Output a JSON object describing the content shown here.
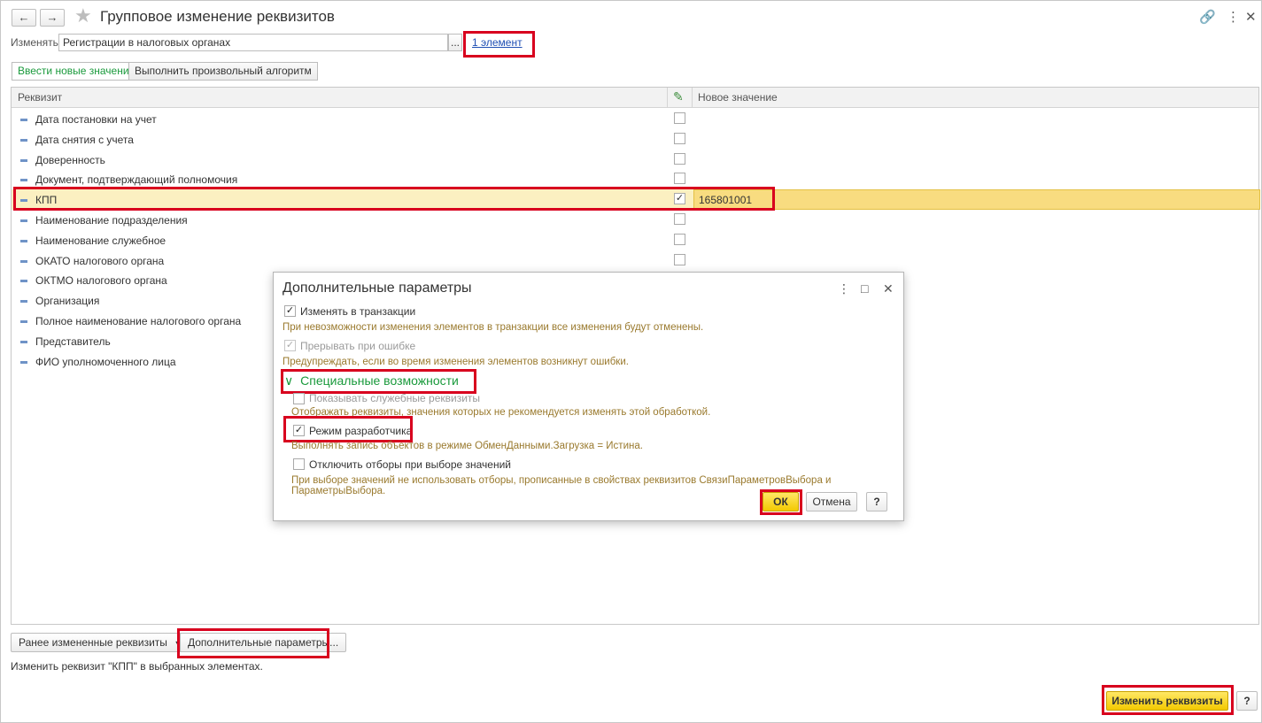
{
  "header": {
    "back_icon": "←",
    "forward_icon": "→",
    "star_icon": "★",
    "title": "Групповое изменение реквизитов",
    "link_icon": "🔗",
    "more_icon": "⋮",
    "close_icon": "✕"
  },
  "edit_row": {
    "label": "Изменять:",
    "value": "Регистрации в налоговых органах",
    "select_label": "...",
    "elements_link": "1 элемент"
  },
  "tabs": [
    {
      "label": "Ввести новые значения",
      "active": true
    },
    {
      "label": "Выполнить произвольный алгоритм",
      "active": false
    }
  ],
  "table": {
    "col_attribute": "Реквизит",
    "col_edit_icon": "✎",
    "col_new_value": "Новое значение",
    "rows": [
      {
        "name": "Дата постановки на учет",
        "checked": false,
        "value": ""
      },
      {
        "name": "Дата снятия с учета",
        "checked": false,
        "value": ""
      },
      {
        "name": "Доверенность",
        "checked": false,
        "value": ""
      },
      {
        "name": "Документ, подтверждающий полномочия",
        "checked": false,
        "value": ""
      },
      {
        "name": "КПП",
        "checked": true,
        "value": "165801001"
      },
      {
        "name": "Наименование подразделения",
        "checked": false,
        "value": ""
      },
      {
        "name": "Наименование служебное",
        "checked": false,
        "value": ""
      },
      {
        "name": "ОКАТО налогового органа",
        "checked": false,
        "value": ""
      },
      {
        "name": "ОКТМО налогового органа",
        "checked": false,
        "value": ""
      },
      {
        "name": "Организация",
        "checked": false,
        "value": ""
      },
      {
        "name": "Полное наименование налогового органа",
        "checked": false,
        "value": ""
      },
      {
        "name": "Представитель",
        "checked": false,
        "value": ""
      },
      {
        "name": "ФИО уполномоченного лица",
        "checked": false,
        "value": ""
      }
    ]
  },
  "check_mark": "✓",
  "bottom": {
    "prev_changed_label": "Ранее измененные реквизиты",
    "dropdown_icon": "▾",
    "extra_params_label": "Дополнительные параметры...",
    "status_text": "Изменить реквизит \"КПП\" в выбранных элементах.",
    "change_button": "Изменить реквизиты",
    "help_label": "?"
  },
  "dialog": {
    "title": "Дополнительные параметры",
    "more_icon": "⋮",
    "maximize_icon": "□",
    "close_icon": "✕",
    "opt_transaction": "Изменять в транзакции",
    "hint_transaction": "При невозможности изменения элементов в транзакции все изменения будут отменены.",
    "opt_abort": "Прерывать при ошибке",
    "hint_abort": "Предупреждать, если во время изменения элементов возникнут ошибки.",
    "section_chevron": "∨",
    "section_title": "Специальные возможности",
    "opt_service": "Показывать служебные реквизиты",
    "hint_service": "Отображать реквизиты, значения которых не рекомендуется изменять этой обработкой.",
    "opt_developer": "Режим разработчика",
    "hint_developer": "Выполнять запись объектов в режиме ОбменДанными.Загрузка = Истина.",
    "opt_filters": "Отключить отборы при выборе значений",
    "hint_filters": "При выборе значений не использовать отборы, прописанные в свойствах реквизитов СвязиПараметровВыбора и ПараметрыВыбора.",
    "ok_label": "ОК",
    "cancel_label": "Отмена",
    "help_label": "?"
  },
  "colors": {
    "highlight": "#d8001e",
    "accent_green": "#1a9a3c",
    "primary_yellow": "#f3c900",
    "selected_row": "#fbf0c1"
  }
}
